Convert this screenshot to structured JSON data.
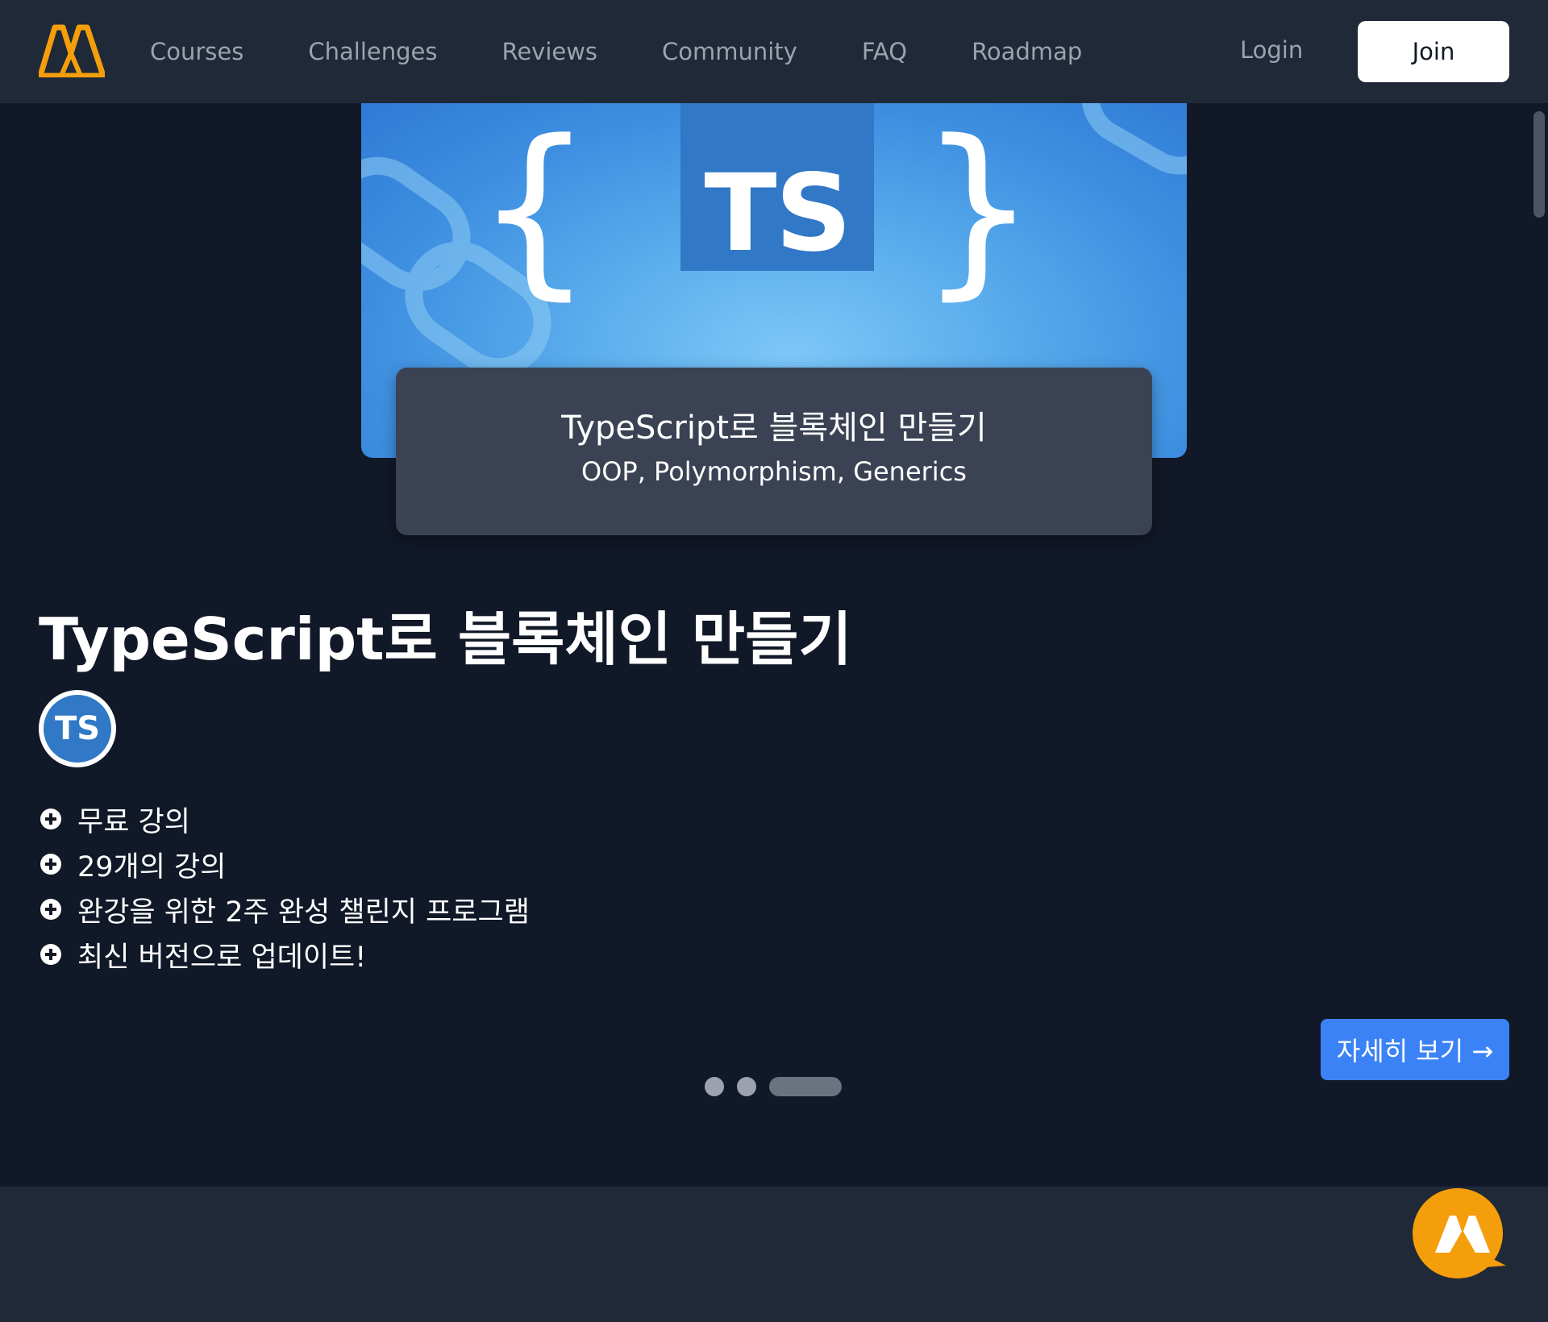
{
  "nav": {
    "links": [
      "Courses",
      "Challenges",
      "Reviews",
      "Community",
      "FAQ",
      "Roadmap"
    ],
    "login": "Login",
    "join": "Join"
  },
  "banner": {
    "badge": "TS",
    "card_title": "TypeScript로 블록체인 만들기",
    "card_subtitle": "OOP, Polymorphism, Generics"
  },
  "course": {
    "title": "TypeScript로 블록체인 만들기",
    "avatar_text": "TS",
    "features": [
      "무료 강의",
      "29개의 강의",
      "완강을 위한 2주 완성 챌린지 프로그램",
      "최신 버전으로 업데이트!"
    ],
    "detail_button": "자세히 보기 →"
  },
  "carousel": {
    "total": 3,
    "active_index": 2
  },
  "colors": {
    "accent_orange": "#f59e0b",
    "ts_blue": "#3178c6",
    "button_blue": "#3b82f6",
    "nav_bg": "#1f2937",
    "page_bg": "#111827"
  },
  "icons": {
    "logo": "nomad-logo-icon",
    "feature": "plus-circle-icon",
    "chat": "chat-bubble-logo-icon"
  }
}
